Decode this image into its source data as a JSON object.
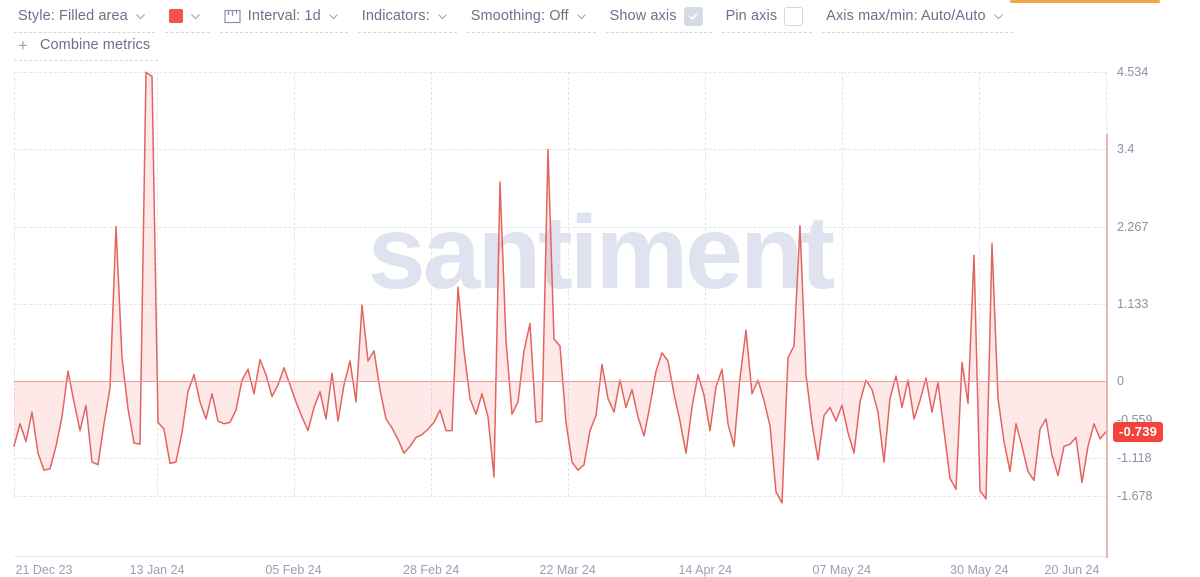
{
  "toolbar": {
    "style": {
      "label": "Style: Filled area",
      "icon": "chevron-down-icon"
    },
    "color": {
      "label": "",
      "swatch_hex": "#f4514e",
      "icon": "chevron-down-icon"
    },
    "interval": {
      "label": "Interval: 1d",
      "icon": "bar-chart-icon"
    },
    "indicators": {
      "label": "Indicators:"
    },
    "smoothing": {
      "label": "Smoothing: Off"
    },
    "show_axis": {
      "label": "Show axis",
      "checked": true
    },
    "pin_axis": {
      "label": "Pin axis",
      "checked": false
    },
    "axis_minmax": {
      "label": "Axis max/min: Auto/Auto"
    },
    "combine": {
      "label": "Combine metrics",
      "plus": "+"
    }
  },
  "chart_data": {
    "type": "area",
    "title": "",
    "xlabel": "",
    "ylabel": "",
    "watermark": "santiment",
    "grid": true,
    "legend": "none",
    "line_color": "#e2645f",
    "fill_color": "rgba(244,81,78,0.13)",
    "zero_line_color": "#e79a98",
    "ylim": [
      -1.678,
      4.534
    ],
    "yticks": [
      4.534,
      3.4,
      2.267,
      1.133,
      0,
      -0.559,
      -1.118,
      -1.678
    ],
    "ytick_labels": [
      "4.534",
      "3.4",
      "2.267",
      "1.133",
      "0",
      "-0.559",
      "-1.118",
      "-1.678"
    ],
    "xtick_labels": [
      "21 Dec 23",
      "13 Jan 24",
      "05 Feb 24",
      "28 Feb 24",
      "22 Mar 24",
      "14 Apr 24",
      "07 May 24",
      "30 May 24",
      "20 Jun 24"
    ],
    "xtick_positions": [
      0.0,
      0.131,
      0.256,
      0.382,
      0.507,
      0.633,
      0.758,
      0.884,
      1.0
    ],
    "current_value": "-0.739",
    "current_value_num": -0.739,
    "values": [
      -0.95,
      -0.62,
      -0.88,
      -0.45,
      -1.05,
      -1.3,
      -1.28,
      -0.95,
      -0.52,
      0.15,
      -0.3,
      -0.72,
      -0.35,
      -1.18,
      -1.22,
      -0.62,
      -0.1,
      2.27,
      0.35,
      -0.4,
      -0.9,
      -0.92,
      4.53,
      4.47,
      -0.6,
      -0.7,
      -1.2,
      -1.18,
      -0.75,
      -0.15,
      0.1,
      -0.3,
      -0.55,
      -0.18,
      -0.58,
      -0.62,
      -0.6,
      -0.42,
      0.02,
      0.18,
      -0.18,
      0.32,
      0.1,
      -0.22,
      -0.05,
      0.2,
      -0.05,
      -0.3,
      -0.52,
      -0.72,
      -0.38,
      -0.15,
      -0.55,
      0.12,
      -0.58,
      -0.05,
      0.3,
      -0.3,
      1.12,
      0.3,
      0.45,
      -0.12,
      -0.55,
      -0.68,
      -0.85,
      -1.05,
      -0.95,
      -0.82,
      -0.78,
      -0.7,
      -0.6,
      -0.42,
      -0.72,
      -0.72,
      1.38,
      0.45,
      -0.25,
      -0.48,
      -0.18,
      -0.52,
      -1.4,
      2.92,
      0.6,
      -0.48,
      -0.3,
      0.45,
      0.85,
      -0.6,
      -0.58,
      3.4,
      0.62,
      0.52,
      -0.6,
      -1.18,
      -1.3,
      -1.22,
      -0.72,
      -0.5,
      0.25,
      -0.25,
      -0.45,
      0.02,
      -0.38,
      -0.12,
      -0.52,
      -0.8,
      -0.35,
      0.15,
      0.42,
      0.3,
      -0.18,
      -0.58,
      -1.05,
      -0.38,
      0.1,
      -0.2,
      -0.72,
      -0.08,
      0.18,
      -0.62,
      -0.95,
      0.05,
      0.75,
      -0.18,
      0.02,
      -0.28,
      -0.65,
      -1.62,
      -1.78,
      0.35,
      0.52,
      2.28,
      0.1,
      -0.62,
      -1.15,
      -0.5,
      -0.38,
      -0.58,
      -0.35,
      -0.75,
      -1.05,
      -0.3,
      0.02,
      -0.12,
      -0.45,
      -1.18,
      -0.25,
      0.08,
      -0.38,
      0.02,
      -0.55,
      -0.28,
      0.05,
      -0.45,
      -0.02,
      -0.72,
      -1.42,
      -1.58,
      0.28,
      -0.32,
      1.85,
      -1.6,
      -1.72,
      2.02,
      -0.25,
      -0.88,
      -1.32,
      -0.62,
      -0.95,
      -1.32,
      -1.45,
      -0.7,
      -0.55,
      -1.08,
      -1.38,
      -0.95,
      -0.92,
      -0.82,
      -1.48,
      -0.95,
      -0.62,
      -0.84,
      -0.739
    ]
  }
}
